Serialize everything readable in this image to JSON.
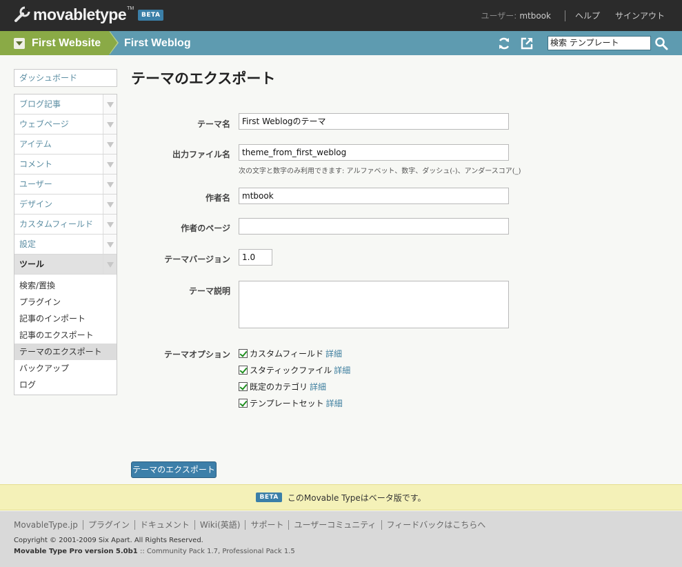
{
  "app": {
    "logo_text": "movabletype",
    "logo_tm": "TM",
    "beta_badge": "BETA"
  },
  "user_nav": {
    "user_label": "ユーザー:",
    "user_name": "mtbook",
    "help": "ヘルプ",
    "signout": "サインアウト"
  },
  "context": {
    "website": "First Website",
    "blog": "First Weblog",
    "search_value": "検索 テンプレート"
  },
  "sidebar": {
    "dashboard": "ダッシュボード",
    "items": [
      {
        "label": "ブログ記事"
      },
      {
        "label": "ウェブページ"
      },
      {
        "label": "アイテム"
      },
      {
        "label": "コメント"
      },
      {
        "label": "ユーザー"
      },
      {
        "label": "デザイン"
      },
      {
        "label": "カスタムフィールド"
      },
      {
        "label": "設定"
      },
      {
        "label": "ツール"
      }
    ],
    "tools_sub": [
      {
        "label": "検索/置換"
      },
      {
        "label": "プラグイン"
      },
      {
        "label": "記事のインポート"
      },
      {
        "label": "記事のエクスポート"
      },
      {
        "label": "テーマのエクスポート"
      },
      {
        "label": "バックアップ"
      },
      {
        "label": "ログ"
      }
    ]
  },
  "main": {
    "title": "テーマのエクスポート",
    "fields": {
      "theme_name_label": "テーマ名",
      "theme_name_value": "First Weblogのテーマ",
      "output_file_label": "出力ファイル名",
      "output_file_value": "theme_from_first_weblog",
      "output_file_hint": "次の文字と数字のみ利用できます: アルファベット、数字、ダッシュ(-)、アンダースコア(_)",
      "author_label": "作者名",
      "author_value": "mtbook",
      "author_page_label": "作者のページ",
      "author_page_value": "",
      "version_label": "テーマバージョン",
      "version_value": "1.0",
      "description_label": "テーマ説明",
      "description_value": "",
      "options_label": "テーマオプション"
    },
    "options": [
      {
        "label": "カスタムフィールド",
        "detail": "詳細",
        "checked": true
      },
      {
        "label": "スタティックファイル",
        "detail": "詳細",
        "checked": true
      },
      {
        "label": "既定のカテゴリ",
        "detail": "詳細",
        "checked": true
      },
      {
        "label": "テンプレートセット",
        "detail": "詳細",
        "checked": true
      }
    ],
    "export_button": "テーマのエクスポート"
  },
  "beta_notice": {
    "badge": "BETA",
    "text": "このMovable Typeはベータ版です。"
  },
  "footer": {
    "links": [
      "MovableType.jp",
      "プラグイン",
      "ドキュメント",
      "Wiki(英語)",
      "サポート",
      "ユーザーコミュニティ",
      "フィードバックはこちらへ"
    ],
    "copyright": "Copyright © 2001-2009 Six Apart. All Rights Reserved.",
    "product": "Movable Type Pro",
    "version": "version 5.0b1",
    "packs": ":: Community Pack 1.7, Professional Pack 1.5"
  }
}
